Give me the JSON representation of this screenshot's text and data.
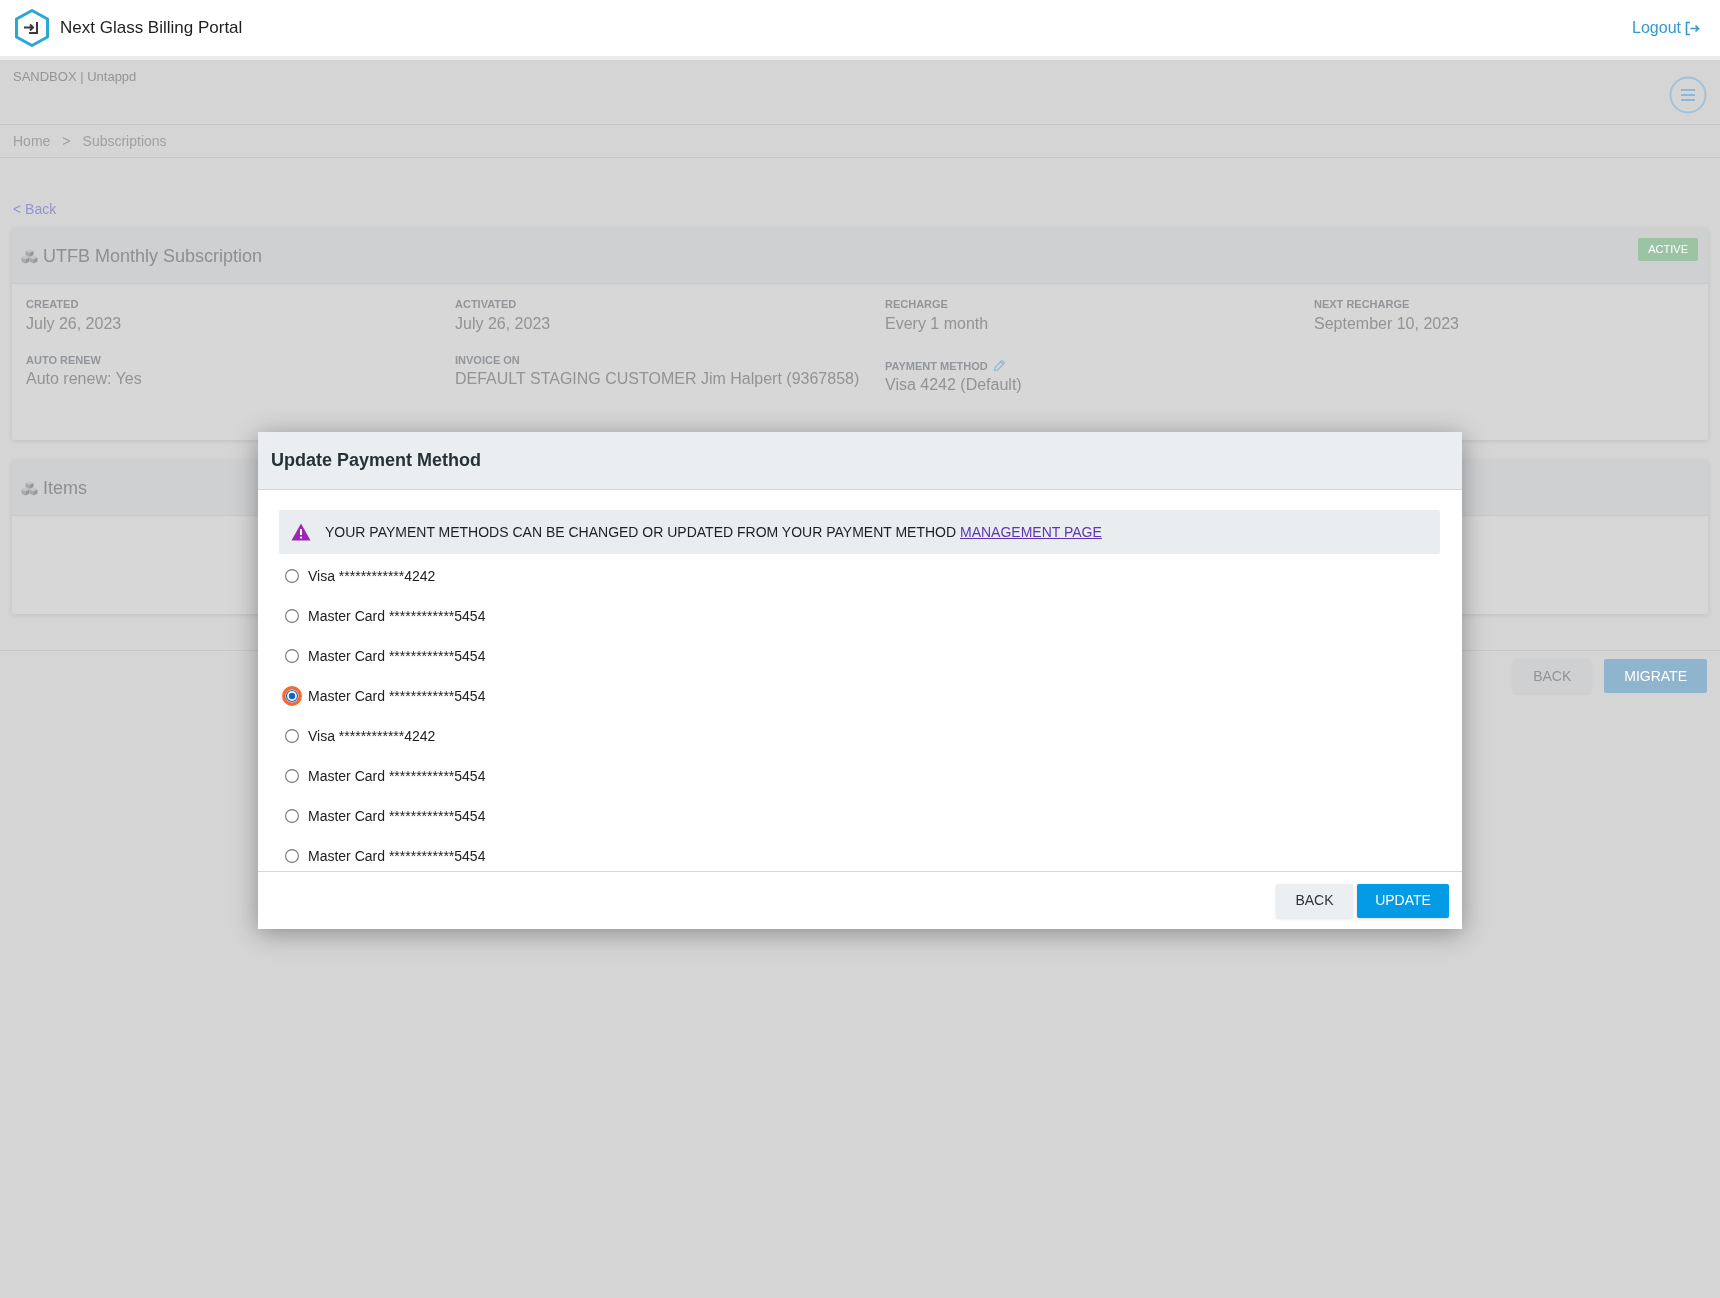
{
  "top_bar": {
    "title": "Next Glass Billing Portal",
    "logout": "Logout"
  },
  "environment": "SANDBOX | Untappd",
  "breadcrumb": {
    "items": [
      "Home",
      "Subscriptions"
    ],
    "separator": ">"
  },
  "back_link": "< Back",
  "subscription": {
    "title": "UTFB Monthly Subscription",
    "status": "ACTIVE",
    "fields": [
      {
        "label": "CREATED",
        "value": "July 26, 2023",
        "editable": false
      },
      {
        "label": "ACTIVATED",
        "value": "July 26, 2023",
        "editable": false
      },
      {
        "label": "RECHARGE",
        "value": "Every 1 month",
        "editable": false
      },
      {
        "label": "NEXT RECHARGE",
        "value": "September 10, 2023",
        "editable": false
      },
      {
        "label": "AUTO RENEW",
        "value": "Auto renew: Yes",
        "editable": false
      },
      {
        "label": "INVOICE ON",
        "value": "DEFAULT STAGING CUSTOMER Jim Halpert (9367858)",
        "editable": false
      },
      {
        "label": "PAYMENT METHOD",
        "value": "Visa 4242 (Default)",
        "editable": true
      }
    ]
  },
  "items_card": {
    "title": "Items"
  },
  "page_buttons": [
    {
      "label": "BACK",
      "kind": "secondary"
    },
    {
      "label": "MIGRATE",
      "kind": "primary"
    }
  ],
  "modal": {
    "title": "Update Payment Method",
    "notice": {
      "text": "YOUR PAYMENT METHODS CAN BE CHANGED OR UPDATED FROM YOUR PAYMENT METHOD",
      "link": "MANAGEMENT PAGE"
    },
    "options": [
      {
        "label": "Visa ************4242",
        "selected": false
      },
      {
        "label": "Master Card ************5454",
        "selected": false
      },
      {
        "label": "Master Card ************5454",
        "selected": false
      },
      {
        "label": "Master Card ************5454",
        "selected": true
      },
      {
        "label": "Visa ************4242",
        "selected": false
      },
      {
        "label": "Master Card ************5454",
        "selected": false
      },
      {
        "label": "Master Card ************5454",
        "selected": false
      },
      {
        "label": "Master Card ************5454",
        "selected": false
      }
    ],
    "buttons": [
      {
        "label": "BACK",
        "kind": "secondary"
      },
      {
        "label": "UPDATE",
        "kind": "primary"
      }
    ]
  }
}
